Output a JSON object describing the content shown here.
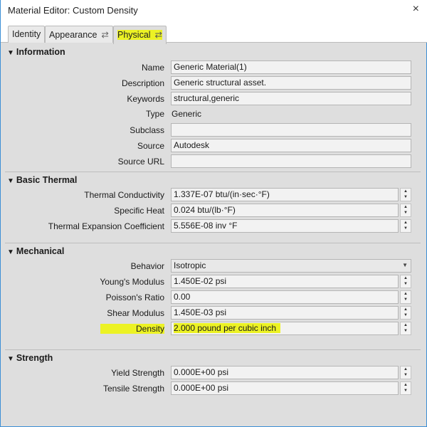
{
  "window": {
    "title": "Material Editor: Custom Density",
    "close_icon": "×"
  },
  "tabs": [
    {
      "label": "Identity"
    },
    {
      "label": "Appearance",
      "icon": "⇄"
    },
    {
      "label": "Physical",
      "icon": "⇄"
    }
  ],
  "highlight_color": "#ecf224",
  "sections": {
    "information": {
      "title": "Information",
      "rows": [
        {
          "label": "Name",
          "value": "Generic Material(1)"
        },
        {
          "label": "Description",
          "value": "Generic structural asset."
        },
        {
          "label": "Keywords",
          "value": "structural,generic"
        },
        {
          "label": "Type",
          "value": "Generic"
        },
        {
          "label": "Subclass",
          "value": ""
        },
        {
          "label": "Source",
          "value": "Autodesk"
        },
        {
          "label": "Source URL",
          "value": ""
        }
      ]
    },
    "thermal": {
      "title": "Basic Thermal",
      "rows": [
        {
          "label": "Thermal Conductivity",
          "value": "1.337E-07 btu/(in·sec·°F)"
        },
        {
          "label": "Specific Heat",
          "value": "0.024 btu/(lb·°F)"
        },
        {
          "label": "Thermal Expansion Coefficient",
          "value": "5.556E-08 inv °F"
        }
      ]
    },
    "mechanical": {
      "title": "Mechanical",
      "rows": [
        {
          "label": "Behavior",
          "value": "Isotropic"
        },
        {
          "label": "Young's Modulus",
          "value": "1.450E-02 psi"
        },
        {
          "label": "Poisson's Ratio",
          "value": "0.00"
        },
        {
          "label": "Shear Modulus",
          "value": "1.450E-03 psi"
        },
        {
          "label": "Density",
          "value": "2.000 pound per cubic inch"
        }
      ]
    },
    "strength": {
      "title": "Strength",
      "rows": [
        {
          "label": "Yield Strength",
          "value": "0.000E+00 psi"
        },
        {
          "label": "Tensile Strength",
          "value": "0.000E+00 psi"
        }
      ]
    }
  }
}
